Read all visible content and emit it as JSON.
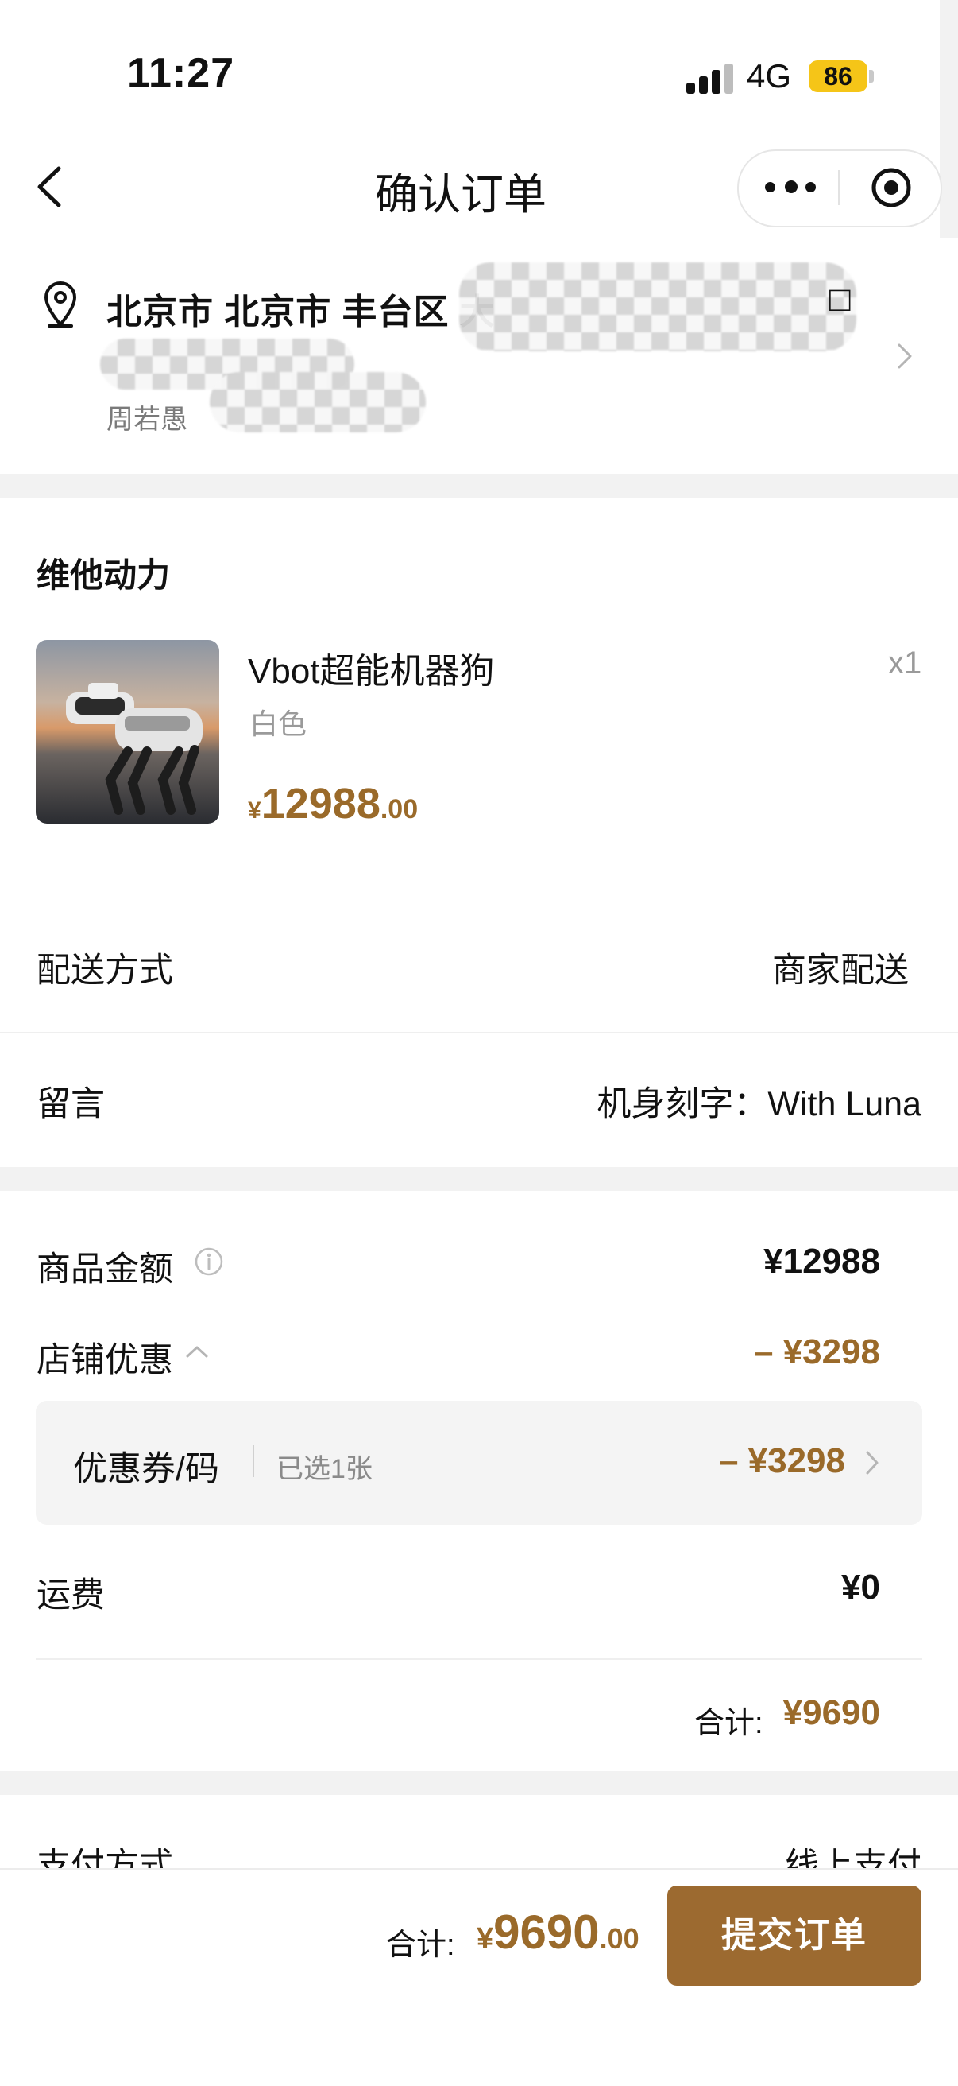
{
  "status_bar": {
    "time": "11:27",
    "network": "4G",
    "battery": "86"
  },
  "nav": {
    "title": "确认订单"
  },
  "address": {
    "line1": "北京市 北京市 丰台区 大",
    "name": "周若愚"
  },
  "shop": {
    "name": "维他动力"
  },
  "product": {
    "name": "Vbot超能机器狗",
    "variant": "白色",
    "qty": "x1",
    "price_currency": "¥",
    "price_int": "12988",
    "price_dec": ".00"
  },
  "delivery": {
    "label": "配送方式",
    "value": "商家配送"
  },
  "note": {
    "label": "留言",
    "value": "机身刻字：With Luna"
  },
  "summary": {
    "goods_label": "商品金额",
    "goods_amount": "¥12988",
    "discount_label": "店铺优惠",
    "discount_value": "– ¥3298",
    "coupon_label": "优惠券/码",
    "coupon_selected": "已选1张",
    "coupon_value": "– ¥3298",
    "shipping_label": "运费",
    "shipping_value": "¥0",
    "subtotal_label": "合计:",
    "subtotal_value": "¥9690"
  },
  "payment": {
    "label": "支付方式",
    "value": "线上支付"
  },
  "bottom": {
    "total_label": "合计:",
    "total_currency": "¥",
    "total_int": "9690",
    "total_dec": ".00",
    "submit": "提交订单"
  },
  "colors": {
    "accent": "#9a6a2a",
    "button": "#9c6a30",
    "badge": "#f5c518"
  }
}
